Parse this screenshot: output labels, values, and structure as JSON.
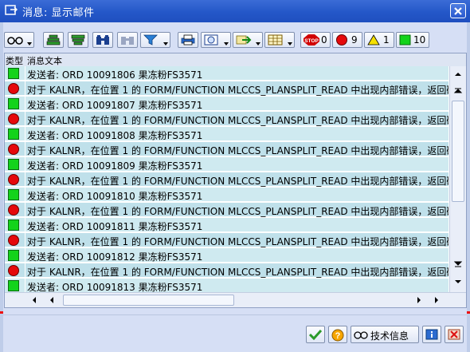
{
  "window": {
    "title": "消息: 显示邮件"
  },
  "toolbar": {
    "counters": [
      {
        "name": "stop",
        "value": "0",
        "color": "#d10000"
      },
      {
        "name": "error",
        "value": "9",
        "color": "#e5090b"
      },
      {
        "name": "warning",
        "value": "1",
        "color": "#f5e000"
      },
      {
        "name": "success",
        "value": "10",
        "color": "#13d31b"
      }
    ],
    "stop_label": "STOP"
  },
  "grid": {
    "col_type": "类型",
    "col_text": "消息文本",
    "rows": [
      {
        "type": "green",
        "text": "发送者: ORD 10091806 果冻粉FS3571"
      },
      {
        "type": "red",
        "text": "对于 KALNR，在位置 1 的 FORM/FUNCTION MLCCS_PLANSPLIT_READ 中出现内部错误，返回码"
      },
      {
        "type": "green",
        "text": "发送者: ORD 10091807 果冻粉FS3571"
      },
      {
        "type": "red",
        "text": "对于 KALNR，在位置 1 的 FORM/FUNCTION MLCCS_PLANSPLIT_READ 中出现内部错误，返回码"
      },
      {
        "type": "green",
        "text": "发送者: ORD 10091808 果冻粉FS3571"
      },
      {
        "type": "red",
        "text": "对于 KALNR，在位置 1 的 FORM/FUNCTION MLCCS_PLANSPLIT_READ 中出现内部错误，返回码"
      },
      {
        "type": "green",
        "text": "发送者: ORD 10091809 果冻粉FS3571"
      },
      {
        "type": "red",
        "text": "对于 KALNR，在位置 1 的 FORM/FUNCTION MLCCS_PLANSPLIT_READ 中出现内部错误，返回码"
      },
      {
        "type": "green",
        "text": "发送者: ORD 10091810 果冻粉FS3571"
      },
      {
        "type": "red",
        "text": "对于 KALNR，在位置 1 的 FORM/FUNCTION MLCCS_PLANSPLIT_READ 中出现内部错误，返回码"
      },
      {
        "type": "green",
        "text": "发送者: ORD 10091811 果冻粉FS3571"
      },
      {
        "type": "red",
        "text": "对于 KALNR，在位置 1 的 FORM/FUNCTION MLCCS_PLANSPLIT_READ 中出现内部错误，返回码"
      },
      {
        "type": "green",
        "text": "发送者: ORD 10091812 果冻粉FS3571"
      },
      {
        "type": "red",
        "text": "对于 KALNR，在位置 1 的 FORM/FUNCTION MLCCS_PLANSPLIT_READ 中出现内部错误，返回码"
      },
      {
        "type": "green",
        "text": "发送者: ORD 10091813 果冻粉FS3571"
      }
    ]
  },
  "footer": {
    "tech_info_label": "技术信息"
  }
}
